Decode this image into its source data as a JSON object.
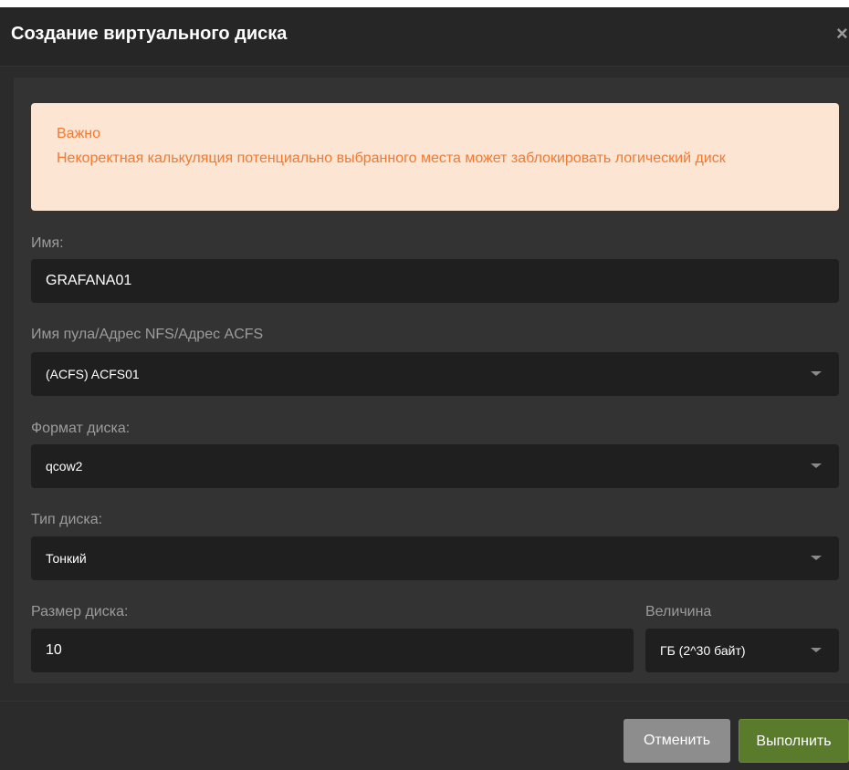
{
  "dialog": {
    "title": "Создание виртуального диска",
    "close_glyph": "×"
  },
  "alert": {
    "heading": "Важно",
    "message": "Некоректная калькуляция потенциально выбранного места может заблокировать логический диск"
  },
  "form": {
    "name": {
      "label": "Имя:",
      "value": "GRAFANA01"
    },
    "pool": {
      "label": "Имя пула/Адрес NFS/Адрес ACFS",
      "value": "(ACFS) ACFS01"
    },
    "format": {
      "label": "Формат диска:",
      "value": "qcow2"
    },
    "type": {
      "label": "Тип диска:",
      "value": "Тонкий"
    },
    "size": {
      "label": "Размер диска:",
      "value": "10"
    },
    "unit": {
      "label": "Величина",
      "value": "ГБ (2^30 байт)"
    }
  },
  "footer": {
    "cancel_label": "Отменить",
    "submit_label": "Выполнить"
  },
  "colors": {
    "alert_text": "#f07a33",
    "alert_bg": "#fde5d4",
    "submit_bg": "#5a7a2c",
    "cancel_bg": "#8d8d8d"
  },
  "icons": [
    "close-icon",
    "chevron-down-icon"
  ]
}
